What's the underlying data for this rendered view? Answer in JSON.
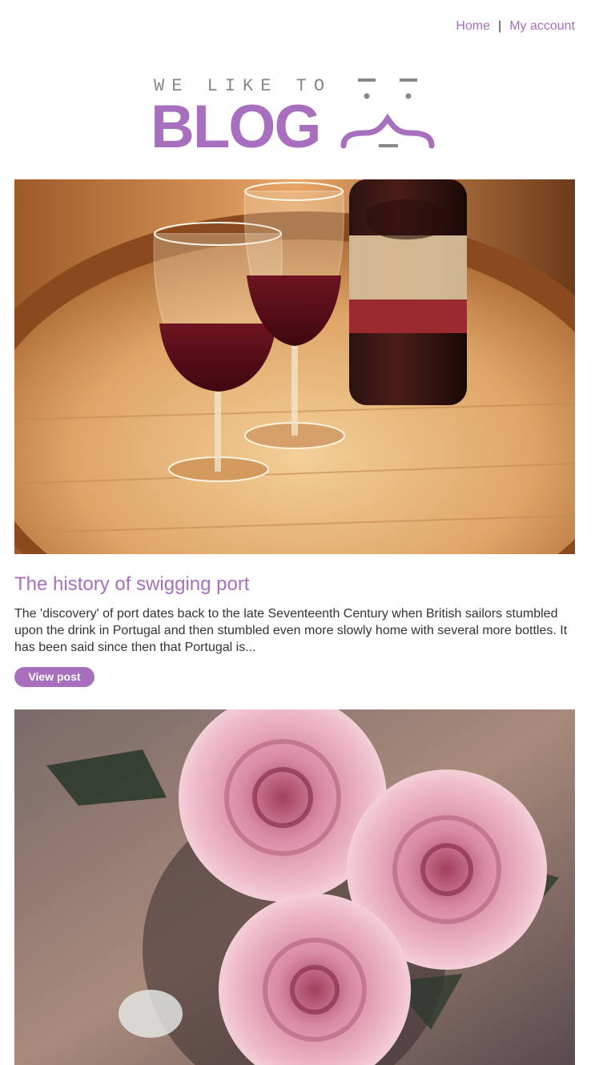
{
  "nav": {
    "home_label": "Home",
    "separator": "|",
    "account_label": "My account"
  },
  "logo": {
    "tagline": "WE LIKE TO",
    "wordmark": "BLOG"
  },
  "posts": [
    {
      "title": "The history of swigging port",
      "excerpt": "The 'discovery' of port dates back to the late Seventeenth Century when British sailors stumbled upon the drink in Portugal and then stumbled even more slowly home with several more bottles. It has been said since then that Portugal is...",
      "button_label": "View post",
      "image_subject": "wine-glasses-on-barrel"
    },
    {
      "image_subject": "pink-roses"
    }
  ],
  "colors": {
    "accent": "#a86fbf",
    "text": "#333333",
    "logo_grey": "#888888"
  }
}
